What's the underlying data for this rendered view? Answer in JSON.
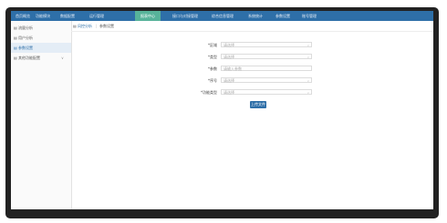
{
  "topnav": {
    "items": [
      "首页概览",
      "功能模块",
      "数据配置",
      "运行管理",
      "报表中心",
      "接口与对接管理",
      "综合信息管理",
      "系统统计",
      "参数设置",
      "账号管理"
    ],
    "active_index": 4
  },
  "sidebar": {
    "items": [
      {
        "icon": "▤",
        "label": "流量分析"
      },
      {
        "icon": "▤",
        "label": "用户分析"
      },
      {
        "icon": "▤",
        "label": "参数设置"
      },
      {
        "icon": "▤",
        "label": "其他功能配置",
        "caret": "∨"
      }
    ],
    "active_index": 2
  },
  "breadcrumb": {
    "items": [
      "风控分析",
      "参数设置"
    ]
  },
  "form": {
    "rows": [
      {
        "label": "*区域",
        "placeholder": "请选择",
        "caret": "∨"
      },
      {
        "label": "*类型",
        "placeholder": "请选择",
        "caret": "∨"
      },
      {
        "label": "*参数",
        "placeholder": "请输入参数",
        "caret": ""
      },
      {
        "label": "*序号",
        "placeholder": "请选择",
        "caret": "∨"
      },
      {
        "label": "*功能类型",
        "placeholder": "请选择",
        "caret": "∨"
      }
    ],
    "submit_label": "上传文件"
  },
  "colors": {
    "nav": "#2e6fa8",
    "nav_active": "#57b39a"
  }
}
